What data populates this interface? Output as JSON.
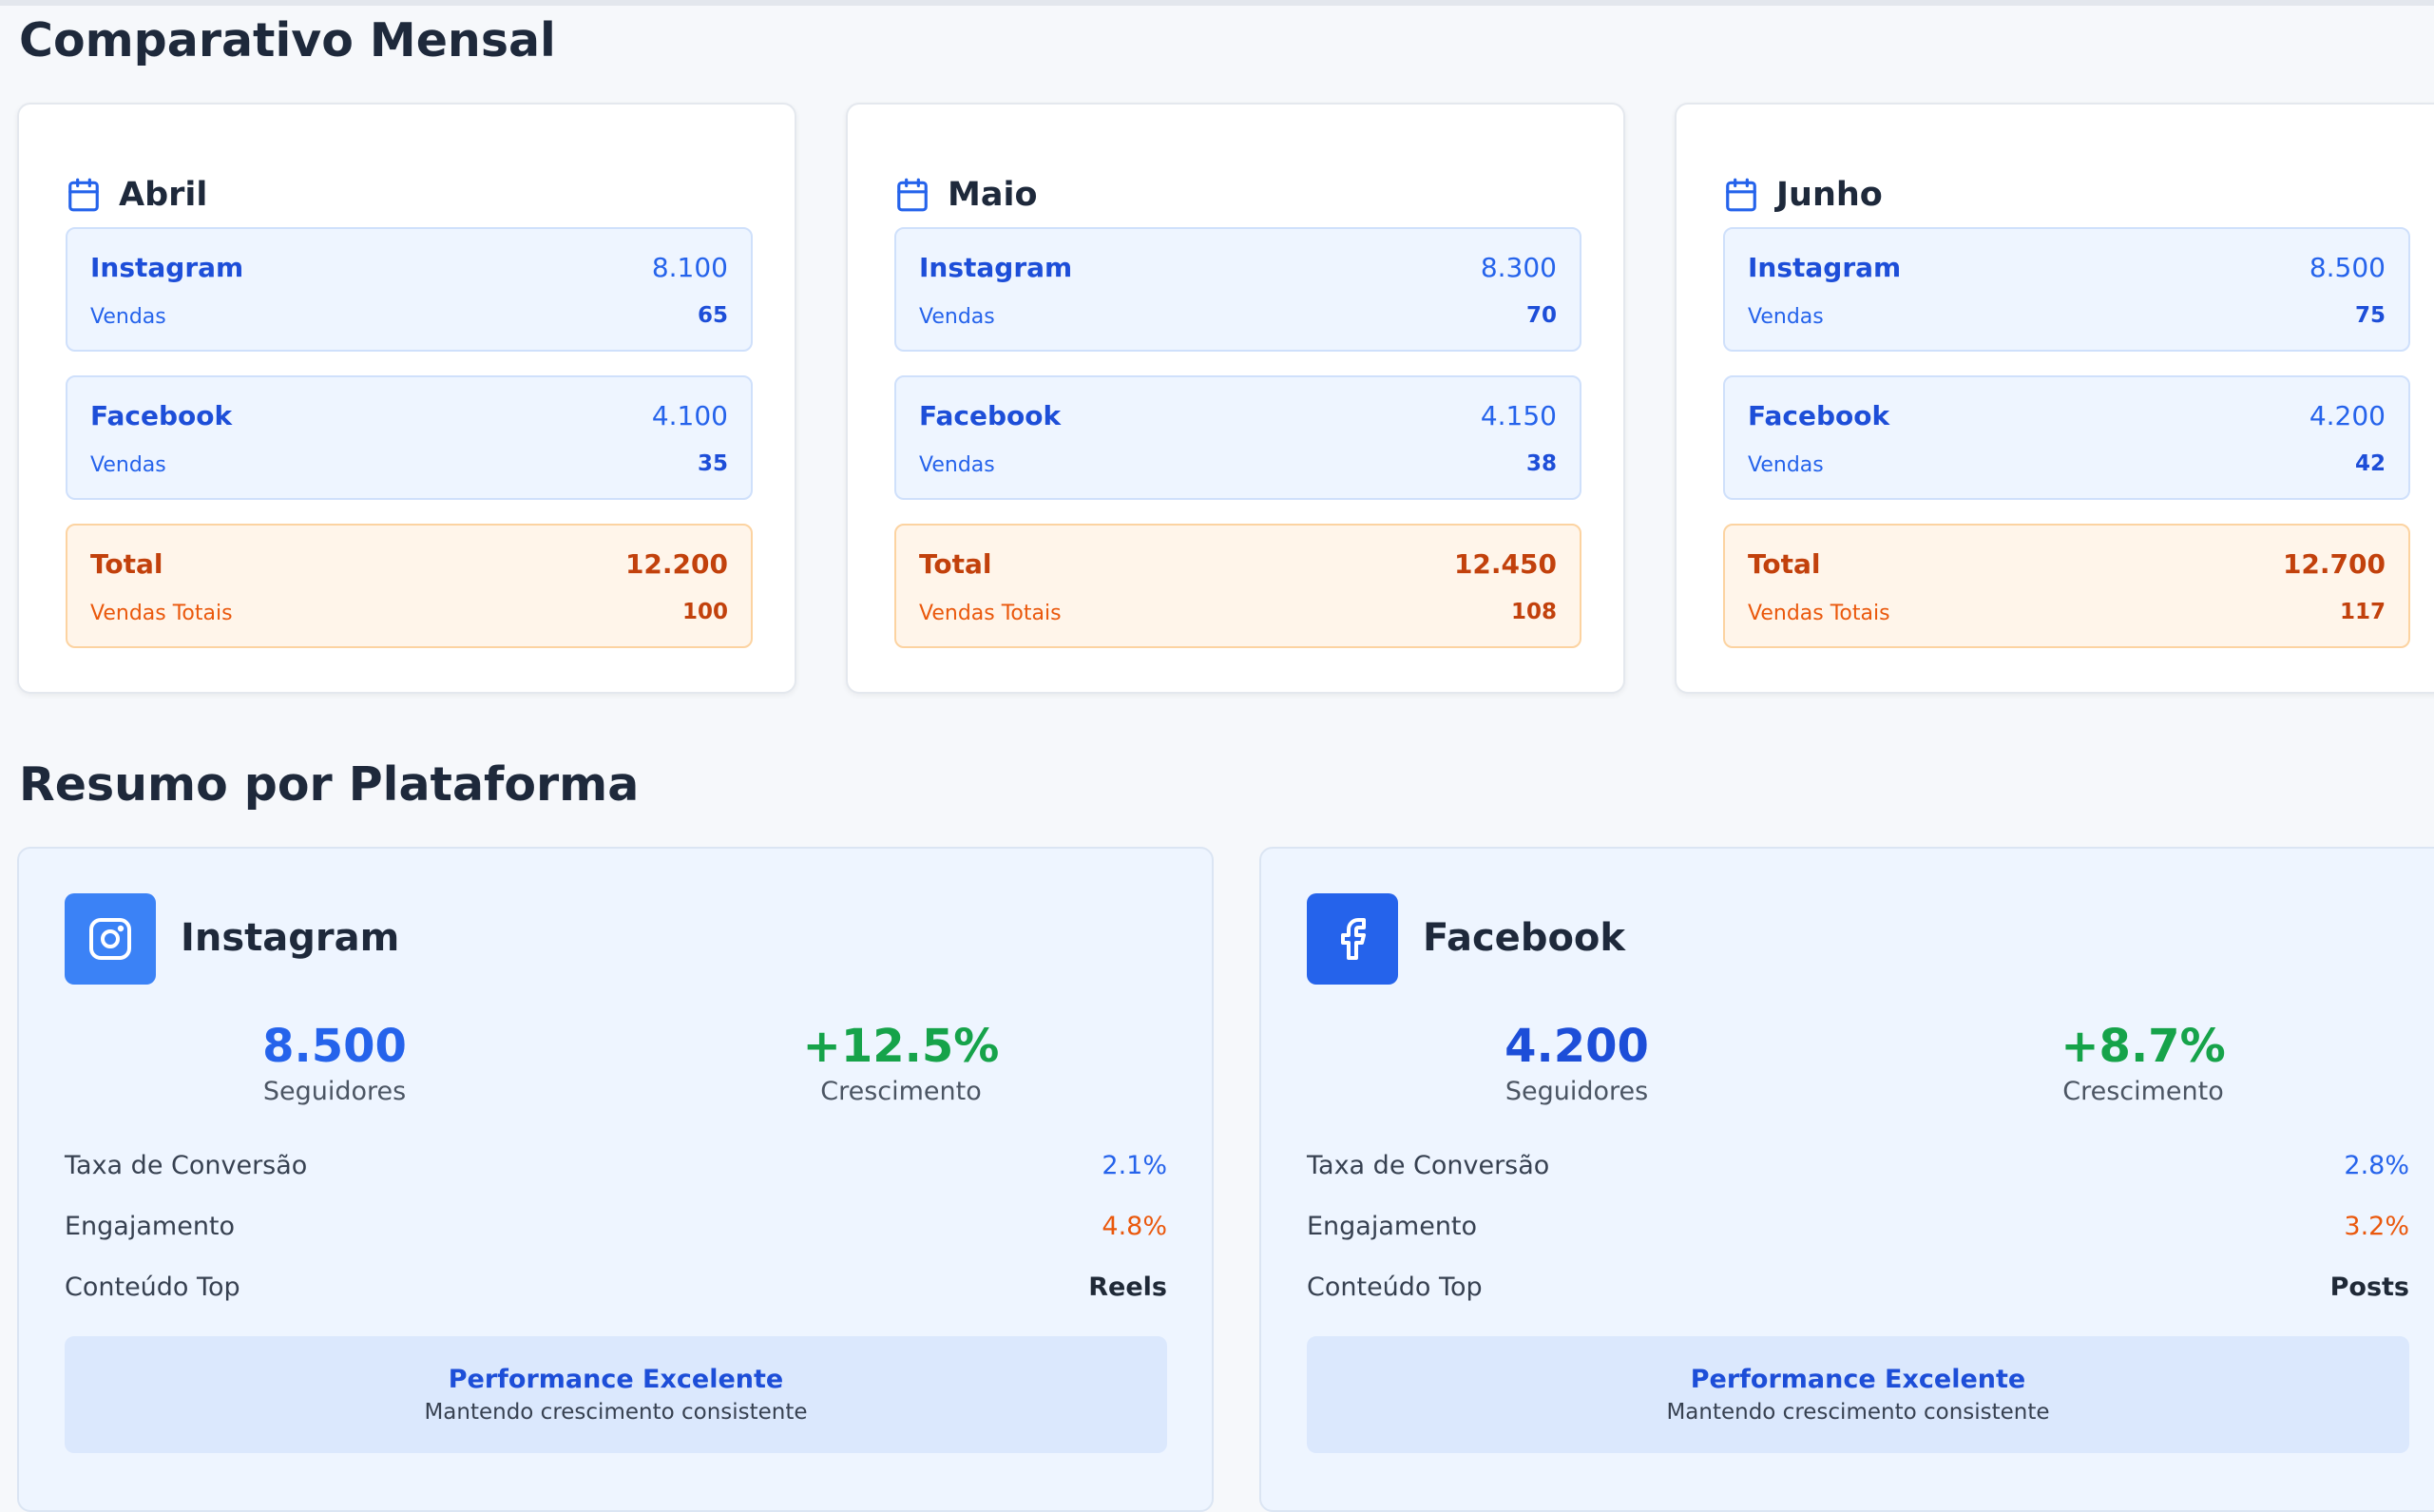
{
  "monthly_section": {
    "title": "Comparativo Mensal",
    "months": [
      {
        "name": "Abril",
        "instagram": {
          "label": "Instagram",
          "value": "8.100",
          "sales_label": "Vendas",
          "sales": "65"
        },
        "facebook": {
          "label": "Facebook",
          "value": "4.100",
          "sales_label": "Vendas",
          "sales": "35"
        },
        "total": {
          "label": "Total",
          "value": "12.200",
          "sales_label": "Vendas Totais",
          "sales": "100"
        }
      },
      {
        "name": "Maio",
        "instagram": {
          "label": "Instagram",
          "value": "8.300",
          "sales_label": "Vendas",
          "sales": "70"
        },
        "facebook": {
          "label": "Facebook",
          "value": "4.150",
          "sales_label": "Vendas",
          "sales": "38"
        },
        "total": {
          "label": "Total",
          "value": "12.450",
          "sales_label": "Vendas Totais",
          "sales": "108"
        }
      },
      {
        "name": "Junho",
        "instagram": {
          "label": "Instagram",
          "value": "8.500",
          "sales_label": "Vendas",
          "sales": "75"
        },
        "facebook": {
          "label": "Facebook",
          "value": "4.200",
          "sales_label": "Vendas",
          "sales": "42"
        },
        "total": {
          "label": "Total",
          "value": "12.700",
          "sales_label": "Vendas Totais",
          "sales": "117"
        }
      }
    ]
  },
  "platform_section": {
    "title": "Resumo por Plataforma",
    "platforms": [
      {
        "name": "Instagram",
        "icon": "instagram-icon",
        "icon_color": "#3b82f6",
        "followers": "8.500",
        "followers_label": "Seguidores",
        "growth": "+12.5%",
        "growth_label": "Crescimento",
        "conversion_label": "Taxa de Conversão",
        "conversion": "2.1%",
        "engagement_label": "Engajamento",
        "engagement": "4.8%",
        "top_content_label": "Conteúdo Top",
        "top_content": "Reels",
        "performance_title": "Performance Excelente",
        "performance_sub": "Mantendo crescimento consistente"
      },
      {
        "name": "Facebook",
        "icon": "facebook-icon",
        "icon_color": "#2563eb",
        "followers": "4.200",
        "followers_label": "Seguidores",
        "growth": "+8.7%",
        "growth_label": "Crescimento",
        "conversion_label": "Taxa de Conversão",
        "conversion": "2.8%",
        "engagement_label": "Engajamento",
        "engagement": "3.2%",
        "top_content_label": "Conteúdo Top",
        "top_content": "Posts",
        "performance_title": "Performance Excelente",
        "performance_sub": "Mantendo crescimento consistente"
      }
    ]
  },
  "colors": {
    "primary_blue": "#2563eb",
    "growth_green": "#16a34a",
    "engagement_orange": "#ea580c",
    "total_orange": "#c2410c"
  }
}
